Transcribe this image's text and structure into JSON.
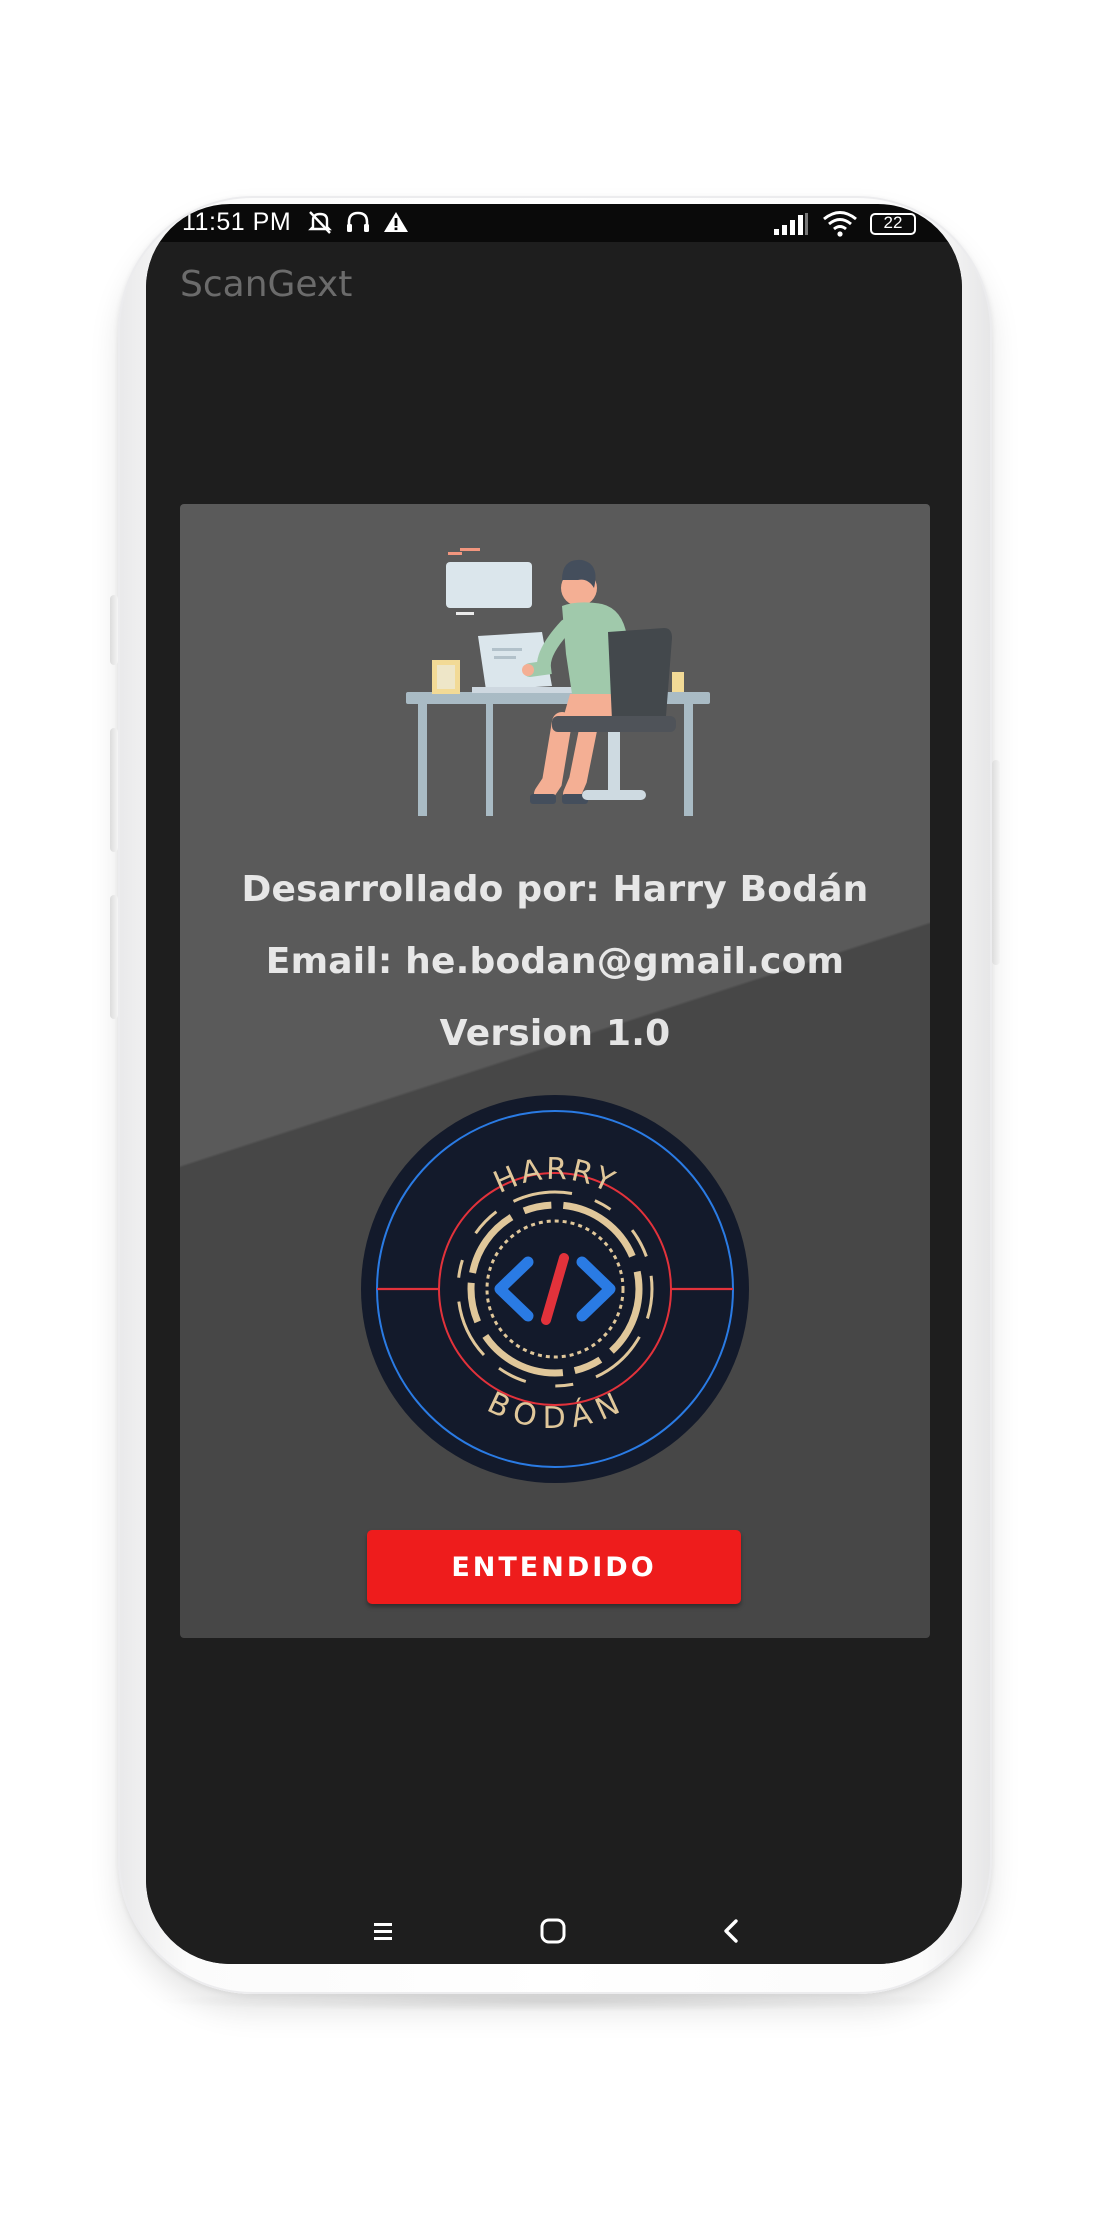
{
  "status_bar": {
    "time": "11:51 PM",
    "battery": "22",
    "icons_left": [
      "mute-bell-icon",
      "headset-icon",
      "warning-icon"
    ],
    "icons_right": [
      "signal-icon",
      "wifi-icon",
      "battery-icon"
    ]
  },
  "app": {
    "title": "ScanGext"
  },
  "dialog": {
    "developer_line": "Desarrollado por: Harry Bodán",
    "email_line": "Email: he.bodan@gmail.com",
    "version_line": "Version 1.0",
    "logo": {
      "top_text": "HARRY",
      "bottom_text": "BODÁN",
      "center_symbol": "</>"
    },
    "confirm_button": "ENTENDIDO"
  },
  "nav_bar": {
    "recents": "recents-icon",
    "home": "home-icon",
    "back": "back-icon"
  },
  "colors": {
    "accent_red": "#ee1c1c",
    "dialog_bg": "#474747",
    "appbar_bg": "#1e1e1e",
    "logo_navy": "#131a2b",
    "logo_blue": "#2a7be4",
    "logo_gold": "#e0c79a"
  }
}
